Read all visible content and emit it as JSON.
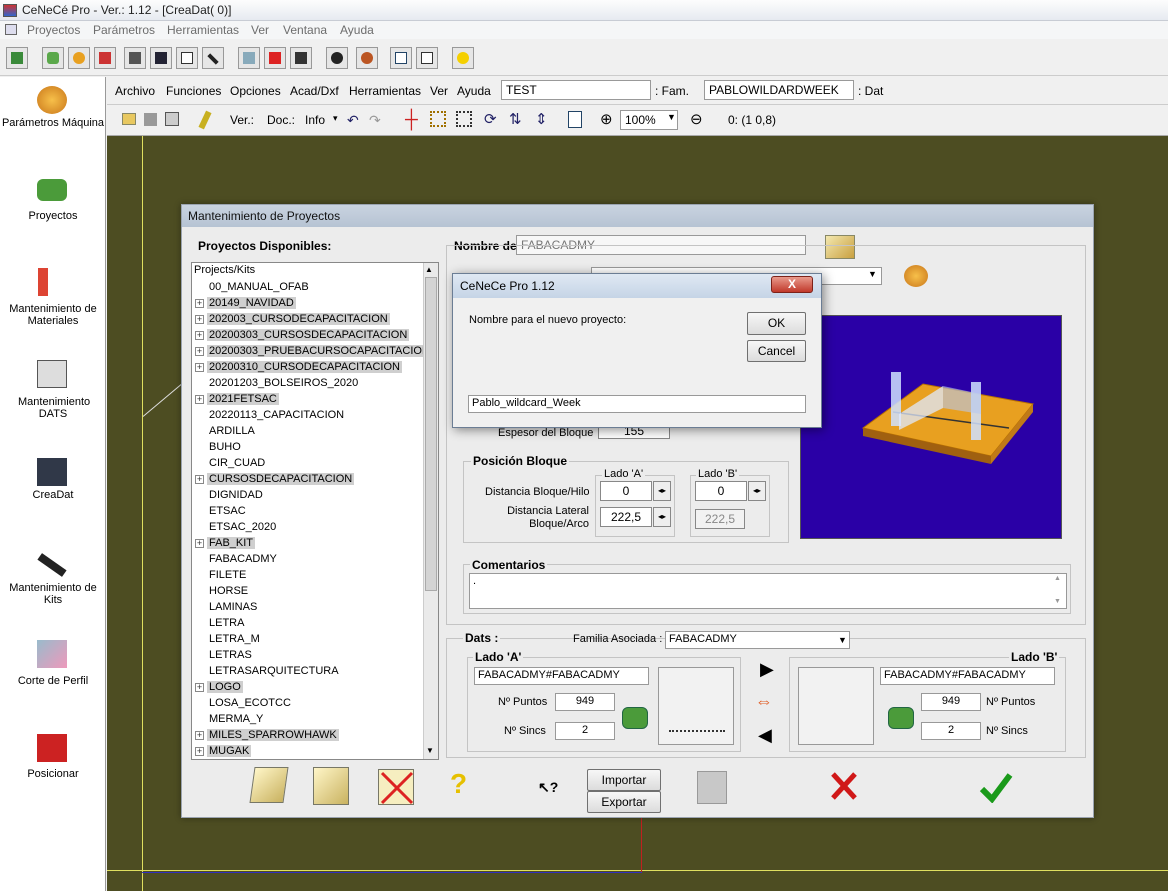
{
  "app": {
    "title": "CeNeCé Pro - Ver.: 1.12 - [CreaDat( 0)]"
  },
  "menu": [
    "Proyectos",
    "Parámetros",
    "Herramientas",
    "Ver",
    "Ventana",
    "Ayuda"
  ],
  "left_panel": [
    {
      "label": "Parámetros Máquina",
      "icon": "gear-icon"
    },
    {
      "label": "Proyectos",
      "icon": "folder-icon"
    },
    {
      "label": "Mantenimiento de Materiales",
      "icon": "materials-icon"
    },
    {
      "label": "Mantenimiento DATS",
      "icon": "dats-icon"
    },
    {
      "label": "CreaDat",
      "icon": "creadat-icon"
    },
    {
      "label": "Mantenimiento de Kits",
      "icon": "kits-icon"
    },
    {
      "label": "Corte de Perfil",
      "icon": "profile-cut-icon"
    },
    {
      "label": "Posicionar",
      "icon": "position-icon"
    }
  ],
  "inner_menu": [
    "Archivo",
    "Funciones",
    "Opciones",
    "Acad/Dxf",
    "Herramientas",
    "Ver",
    "Ayuda"
  ],
  "header_fields": {
    "project": "TEST",
    "fam_label": ": Fam.",
    "family": "PABLOWILDARDWEEK",
    "dat_label": ": Dat"
  },
  "inner_toolbar": {
    "ver_label": "Ver.:",
    "doc_label": "Doc.:",
    "info_label": "Info",
    "zoom": "100%",
    "coords": "0: (1 0,8)"
  },
  "window": {
    "title": "Mantenimiento de Proyectos",
    "projects_label": "Proyectos Disponibles:",
    "tree_root": "Projects/Kits",
    "tree_items": [
      {
        "label": "00_MANUAL_OFAB",
        "expandable": false,
        "selected": false
      },
      {
        "label": "20149_NAVIDAD",
        "expandable": true,
        "selected": true
      },
      {
        "label": "202003_CURSODECAPACITACION",
        "expandable": true,
        "selected": true
      },
      {
        "label": "20200303_CURSOSDECAPACITACION",
        "expandable": true,
        "selected": true
      },
      {
        "label": "20200303_PRUEBACURSOCAPACITACION",
        "expandable": true,
        "selected": true
      },
      {
        "label": "20200310_CURSODECAPACITACION",
        "expandable": true,
        "selected": true
      },
      {
        "label": "20201203_BOLSEIROS_2020",
        "expandable": false,
        "selected": false
      },
      {
        "label": "2021FETSAC",
        "expandable": true,
        "selected": true
      },
      {
        "label": "20220113_CAPACITACION",
        "expandable": false,
        "selected": false
      },
      {
        "label": "ARDILLA",
        "expandable": false,
        "selected": false
      },
      {
        "label": "BUHO",
        "expandable": false,
        "selected": false
      },
      {
        "label": "CIR_CUAD",
        "expandable": false,
        "selected": false
      },
      {
        "label": "CURSOSDECAPACITACION",
        "expandable": true,
        "selected": true
      },
      {
        "label": "DIGNIDAD",
        "expandable": false,
        "selected": false
      },
      {
        "label": "ETSAC",
        "expandable": false,
        "selected": false
      },
      {
        "label": "ETSAC_2020",
        "expandable": false,
        "selected": false
      },
      {
        "label": "FAB_KIT",
        "expandable": true,
        "selected": true
      },
      {
        "label": "FABACADMY",
        "expandable": false,
        "selected": false
      },
      {
        "label": "FILETE",
        "expandable": false,
        "selected": false
      },
      {
        "label": "HORSE",
        "expandable": false,
        "selected": false
      },
      {
        "label": "LAMINAS",
        "expandable": false,
        "selected": false
      },
      {
        "label": "LETRA",
        "expandable": false,
        "selected": false
      },
      {
        "label": "LETRA_M",
        "expandable": false,
        "selected": false
      },
      {
        "label": "LETRAS",
        "expandable": false,
        "selected": false
      },
      {
        "label": "LETRASARQUITECTURA",
        "expandable": false,
        "selected": false
      },
      {
        "label": "LOGO",
        "expandable": true,
        "selected": true
      },
      {
        "label": "LOSA_ECOTCC",
        "expandable": false,
        "selected": false
      },
      {
        "label": "MERMA_Y",
        "expandable": false,
        "selected": false
      },
      {
        "label": "MILES_SPARROWHAWK",
        "expandable": true,
        "selected": true
      },
      {
        "label": "MUGAK",
        "expandable": true,
        "selected": true
      }
    ],
    "nombre_label": "Nombre de",
    "nombre_value": "FABACADMY",
    "material_value": "",
    "espesor_label": "Espesor del Bloque",
    "espesor_value": "155",
    "posicion_label": "Posición Bloque",
    "lado_a_label": "Lado 'A'",
    "lado_b_label": "Lado 'B'",
    "dist_hilo_label": "Distancia Bloque/Hilo",
    "dist_lateral_label": "Distancia Lateral Bloque/Arco",
    "dist_hilo_a": "0",
    "dist_hilo_b": "0",
    "dist_lat_a": "222,5",
    "dist_lat_b": "222,5",
    "comentarios_label": "Comentarios",
    "comentarios_value": ".",
    "dats_label": "Dats :",
    "familia_label": "Familia Asociada :",
    "familia_value": "FABACADMY",
    "dats_lado_a": "Lado 'A'",
    "dats_lado_b": "Lado 'B'",
    "dat_a_name": "FABACADMY#FABACADMY",
    "dat_b_name": "FABACADMY#FABACADMY",
    "puntos_label": "Nº Puntos",
    "sincs_label": "Nº Sincs",
    "puntos_a": "949",
    "puntos_b": "949",
    "sincs_a": "2",
    "sincs_b": "2",
    "importar": "Importar",
    "exportar": "Exportar"
  },
  "dialog": {
    "title": "CeNeCe Pro 1.12",
    "close": "X",
    "prompt": "Nombre para el nuevo proyecto:",
    "ok": "OK",
    "cancel": "Cancel",
    "input": "Pablo_wildcard_Week"
  },
  "colors": {
    "canvas": "#4d4d22",
    "preview": "#2a00a6",
    "block": "#e8a020"
  }
}
